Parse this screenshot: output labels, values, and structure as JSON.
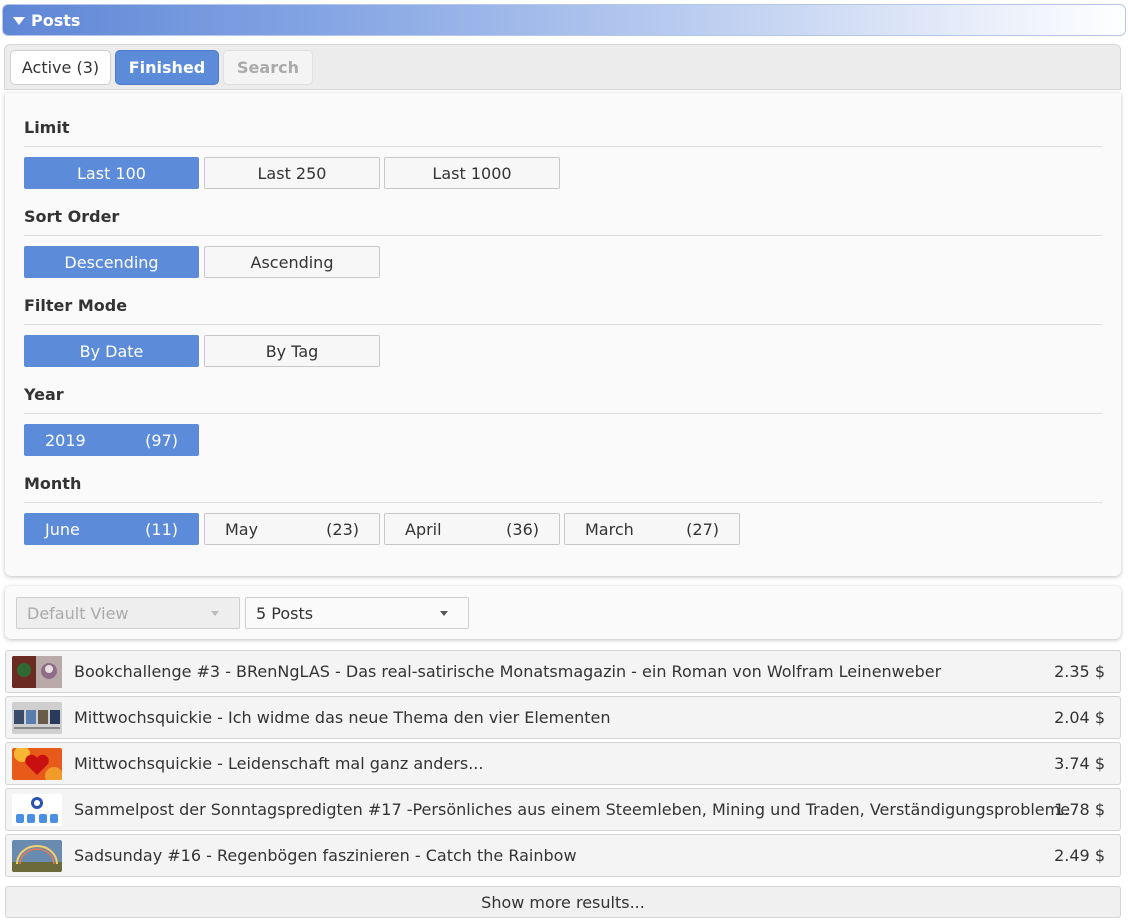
{
  "header": {
    "title": "Posts"
  },
  "tabs": [
    {
      "label": "Active (3)"
    },
    {
      "label": "Finished"
    },
    {
      "label": "Search"
    }
  ],
  "filters": {
    "limit": {
      "label": "Limit",
      "options": [
        "Last 100",
        "Last 250",
        "Last 1000"
      ],
      "selected": "Last 100"
    },
    "sort": {
      "label": "Sort Order",
      "options": [
        "Descending",
        "Ascending"
      ],
      "selected": "Descending"
    },
    "mode": {
      "label": "Filter Mode",
      "options": [
        "By Date",
        "By Tag"
      ],
      "selected": "By Date"
    },
    "year": {
      "label": "Year",
      "options": [
        {
          "name": "2019",
          "count": "(97)"
        }
      ],
      "selected": "2019"
    },
    "month": {
      "label": "Month",
      "options": [
        {
          "name": "June",
          "count": "(11)"
        },
        {
          "name": "May",
          "count": "(23)"
        },
        {
          "name": "April",
          "count": "(36)"
        },
        {
          "name": "March",
          "count": "(27)"
        }
      ],
      "selected": "June"
    }
  },
  "view": {
    "view_select": "Default View",
    "count_select": "5 Posts"
  },
  "posts": [
    {
      "title": "Bookchallenge #3 - BRenNgLAS - Das real-satirische Monatsmagazin - ein Roman von Wolfram Leinenweber",
      "value": "2.35 $"
    },
    {
      "title": "Mittwochsquickie - Ich widme das neue Thema den vier Elementen",
      "value": "2.04 $"
    },
    {
      "title": "Mittwochsquickie - Leidenschaft mal ganz anders...",
      "value": "3.74 $"
    },
    {
      "title": "Sammelpost der Sonntagspredigten #17 -Persönliches aus einem Steemleben, Mining und Traden, Verständigungsprobleme",
      "value": "1.78 $"
    },
    {
      "title": "Sadsunday #16 - Regenbögen faszinieren - Catch the Rainbow",
      "value": "2.49 $"
    }
  ],
  "show_more": "Show more results...",
  "colors": {
    "accent": "#5b8bd9"
  }
}
